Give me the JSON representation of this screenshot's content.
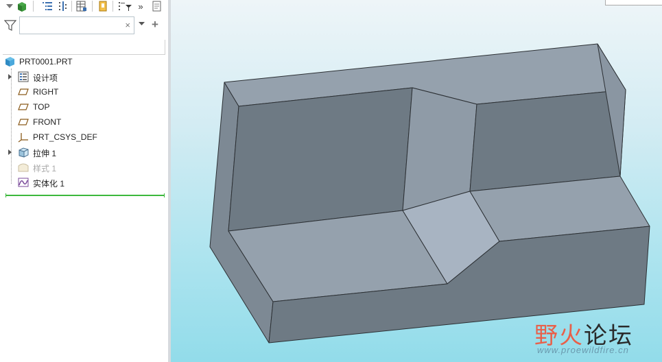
{
  "toolbar": {
    "icons": [
      "dropdown-arrow-icon",
      "part-icon",
      "tree-list-icon",
      "tree-columns-icon",
      "table-icon",
      "highlight-icon",
      "tree-filter-icon",
      "more-icon",
      "notes-icon"
    ],
    "more_label": "»"
  },
  "search": {
    "value": "",
    "clear_glyph": "×",
    "add_glyph": "+"
  },
  "tree": {
    "root": "PRT0001.PRT",
    "items": [
      {
        "label": "设计项",
        "icon": "design-items-icon",
        "expandable": true,
        "suppressed": false
      },
      {
        "label": "RIGHT",
        "icon": "datum-plane-icon",
        "expandable": false,
        "suppressed": false
      },
      {
        "label": "TOP",
        "icon": "datum-plane-icon",
        "expandable": false,
        "suppressed": false
      },
      {
        "label": "FRONT",
        "icon": "datum-plane-icon",
        "expandable": false,
        "suppressed": false
      },
      {
        "label": "PRT_CSYS_DEF",
        "icon": "csys-icon",
        "expandable": false,
        "suppressed": false
      },
      {
        "label": "拉伸 1",
        "icon": "extrude-icon",
        "expandable": true,
        "suppressed": false
      },
      {
        "label": "样式 1",
        "icon": "style-icon",
        "expandable": false,
        "suppressed": true
      },
      {
        "label": "实体化 1",
        "icon": "solidify-icon",
        "expandable": false,
        "suppressed": false
      }
    ]
  },
  "colors": {
    "insert_marker": "#3cb83c",
    "model_top": "#95a1ad",
    "model_side": "#6e7a84",
    "model_chamfer": "#a8b4c2",
    "suppressed_text": "#a9a9a9"
  },
  "watermark": {
    "chars": [
      "野",
      "火",
      "论坛"
    ],
    "url": "www.proewildfire.cn"
  }
}
